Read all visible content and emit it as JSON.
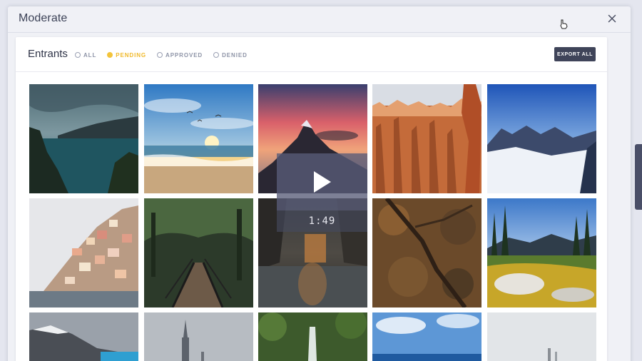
{
  "modal": {
    "title": "Moderate"
  },
  "entrants": {
    "title": "Entrants",
    "filters": [
      {
        "label": "ALL",
        "selected": false
      },
      {
        "label": "PENDING",
        "selected": true
      },
      {
        "label": "APPROVED",
        "selected": false
      },
      {
        "label": "DENIED",
        "selected": false
      }
    ],
    "export_label": "EXPORT ALL"
  },
  "video": {
    "duration": "1:49"
  },
  "tiles": [
    {
      "subject": "lake-cliffs"
    },
    {
      "subject": "beach-sunset"
    },
    {
      "subject": "mountain-peak-sunset"
    },
    {
      "subject": "red-rock-hoodoos"
    },
    {
      "subject": "snowy-mountains"
    },
    {
      "subject": "cliffside-village"
    },
    {
      "subject": "forest-bridge"
    },
    {
      "subject": "coastal-rocks"
    },
    {
      "subject": "aerial-forest"
    },
    {
      "subject": "alpine-meadow"
    },
    {
      "subject": "mountain-ridge"
    },
    {
      "subject": "city-spire"
    },
    {
      "subject": "jungle-waterfall"
    },
    {
      "subject": "ocean-horizon"
    },
    {
      "subject": "misty-coast"
    }
  ],
  "colors": {
    "accent": "#f3c43a",
    "button": "#3f4459"
  }
}
